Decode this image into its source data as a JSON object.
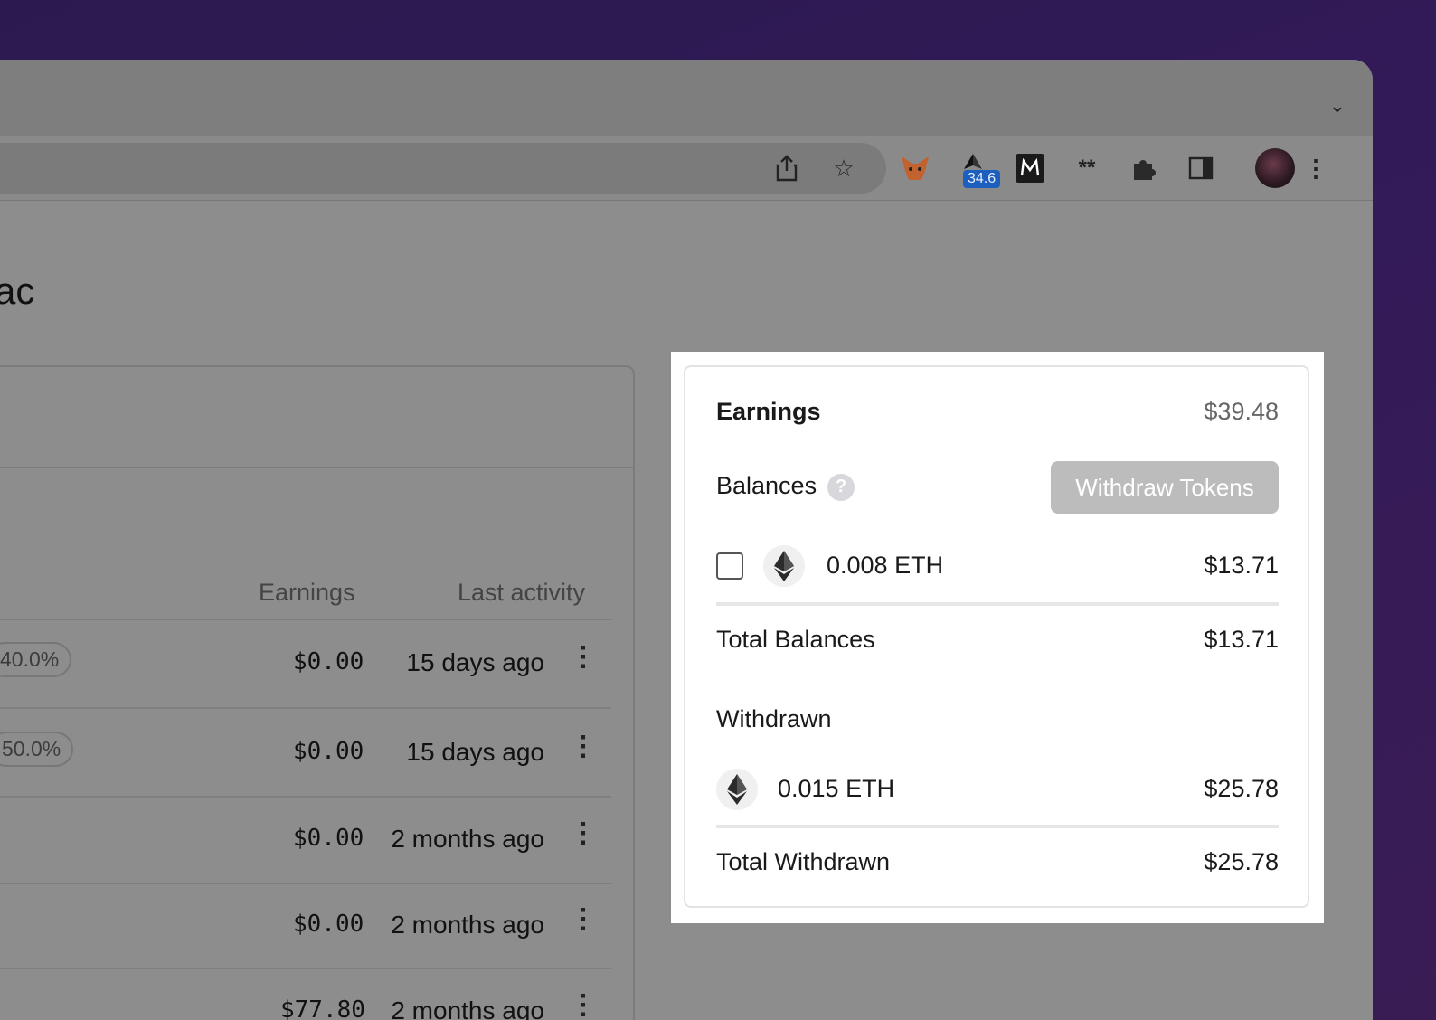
{
  "browser": {
    "toolbar": {
      "badge_value": "34.6"
    }
  },
  "page": {
    "title_fragment": "ac",
    "table": {
      "headers": {
        "earnings": "Earnings",
        "last_activity": "Last activity"
      },
      "rows": [
        {
          "percent": "40.0%",
          "earnings": "$0.00",
          "last_activity": "15 days ago"
        },
        {
          "percent": "50.0%",
          "earnings": "$0.00",
          "last_activity": "15 days ago"
        },
        {
          "percent": "",
          "earnings": "$0.00",
          "last_activity": "2 months ago"
        },
        {
          "percent": "",
          "earnings": "$0.00",
          "last_activity": "2 months ago"
        },
        {
          "percent": "",
          "earnings": "$77.80",
          "last_activity": "2 months ago"
        }
      ]
    }
  },
  "panel": {
    "earnings_label": "Earnings",
    "earnings_value": "$39.48",
    "balances_label": "Balances",
    "help_symbol": "?",
    "withdraw_button": "Withdraw Tokens",
    "balance_item": {
      "amount": "0.008 ETH",
      "usd": "$13.71"
    },
    "total_balances_label": "Total Balances",
    "total_balances_value": "$13.71",
    "withdrawn_label": "Withdrawn",
    "withdrawn_item": {
      "amount": "0.015 ETH",
      "usd": "$25.78"
    },
    "total_withdrawn_label": "Total Withdrawn",
    "total_withdrawn_value": "$25.78"
  }
}
